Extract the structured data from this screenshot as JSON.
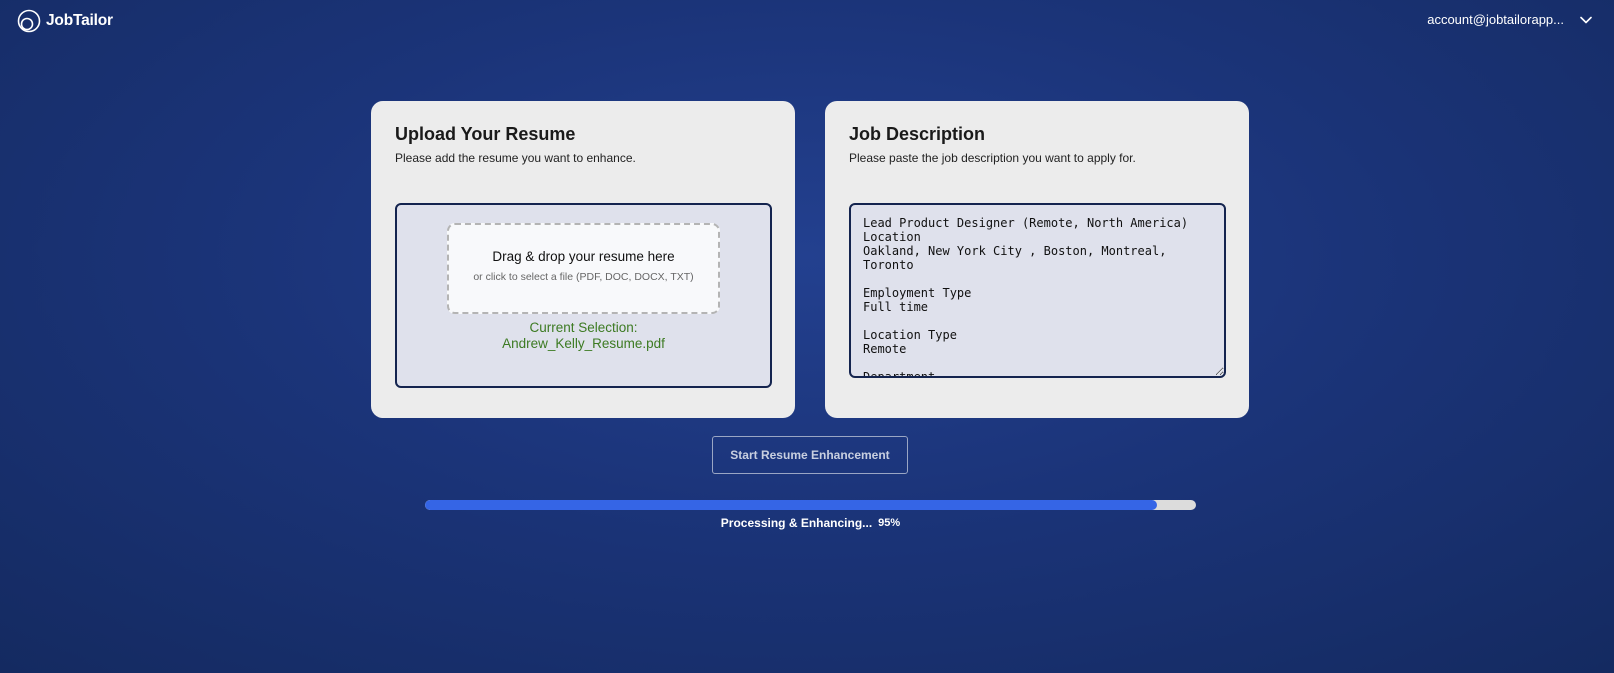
{
  "header": {
    "logo_text": "JobTailor",
    "account_email": "account@jobtailorapp..."
  },
  "upload": {
    "title": "Upload Your Resume",
    "subtitle": "Please add the resume you want to enhance.",
    "dropzone_title": "Drag & drop your resume here",
    "dropzone_subtitle": "or click to select a file (PDF, DOC, DOCX, TXT)",
    "selection_label": "Current Selection:",
    "selection_file": "Andrew_Kelly_Resume.pdf"
  },
  "job": {
    "title": "Job Description",
    "subtitle": "Please paste the job description you want to apply for.",
    "text": "Lead Product Designer (Remote, North America)\nLocation\nOakland, New York City , Boston, Montreal, Toronto\n\nEmployment Type\nFull time\n\nLocation Type\nRemote\n\nDepartment"
  },
  "actions": {
    "start_label": "Start Resume Enhancement"
  },
  "progress": {
    "percent": 95,
    "percent_label": "95%",
    "label": "Processing & Enhancing..."
  },
  "colors": {
    "progress_fill": "#3565e6",
    "selection_text": "#3c7a22"
  },
  "icons": {
    "logo": "jobtailor-rings-icon",
    "account_menu": "chevron-down-icon"
  }
}
